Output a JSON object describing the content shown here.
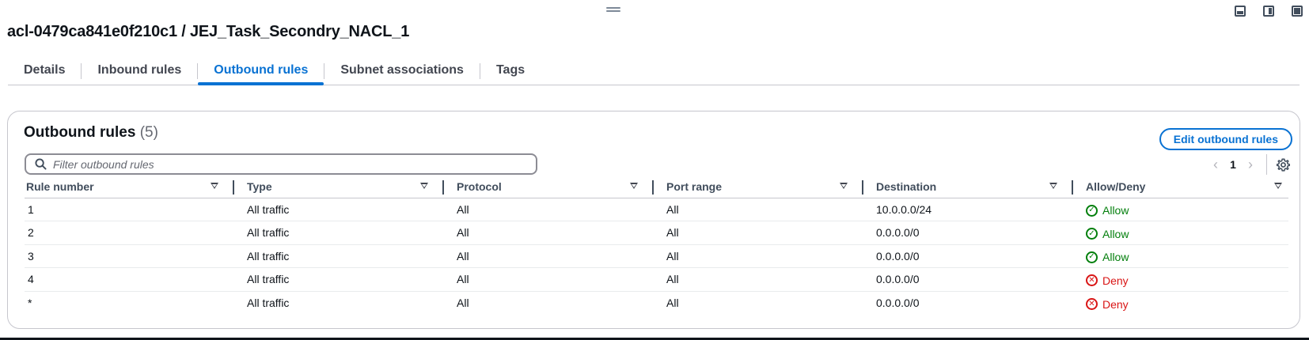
{
  "window": {
    "layout_icons": [
      "panel-bottom-icon",
      "panel-side-icon",
      "panel-full-icon"
    ]
  },
  "page": {
    "title": "acl-0479ca841e0f210c1 / JEJ_Task_Secondry_NACL_1"
  },
  "tabs": [
    {
      "label": "Details",
      "active": false
    },
    {
      "label": "Inbound rules",
      "active": false
    },
    {
      "label": "Outbound rules",
      "active": true
    },
    {
      "label": "Subnet associations",
      "active": false
    },
    {
      "label": "Tags",
      "active": false
    }
  ],
  "panel": {
    "title": "Outbound rules",
    "count": "(5)",
    "edit_button": "Edit outbound rules",
    "filter_placeholder": "Filter outbound rules",
    "pagination": {
      "current_page": "1",
      "prev": "‹",
      "next": "›"
    }
  },
  "table": {
    "columns": [
      "Rule number",
      "Type",
      "Protocol",
      "Port range",
      "Destination",
      "Allow/Deny"
    ],
    "rows": [
      {
        "rule": "1",
        "type": "All traffic",
        "protocol": "All",
        "port_range": "All",
        "destination": "10.0.0.0/24",
        "action": "Allow"
      },
      {
        "rule": "2",
        "type": "All traffic",
        "protocol": "All",
        "port_range": "All",
        "destination": "0.0.0.0/0",
        "action": "Allow"
      },
      {
        "rule": "3",
        "type": "All traffic",
        "protocol": "All",
        "port_range": "All",
        "destination": "0.0.0.0/0",
        "action": "Allow"
      },
      {
        "rule": "4",
        "type": "All traffic",
        "protocol": "All",
        "port_range": "All",
        "destination": "0.0.0.0/0",
        "action": "Deny"
      },
      {
        "rule": "*",
        "type": "All traffic",
        "protocol": "All",
        "port_range": "All",
        "destination": "0.0.0.0/0",
        "action": "Deny"
      }
    ]
  },
  "colors": {
    "accent": "#0972d3",
    "allow": "#037f0c",
    "deny": "#d91515"
  }
}
